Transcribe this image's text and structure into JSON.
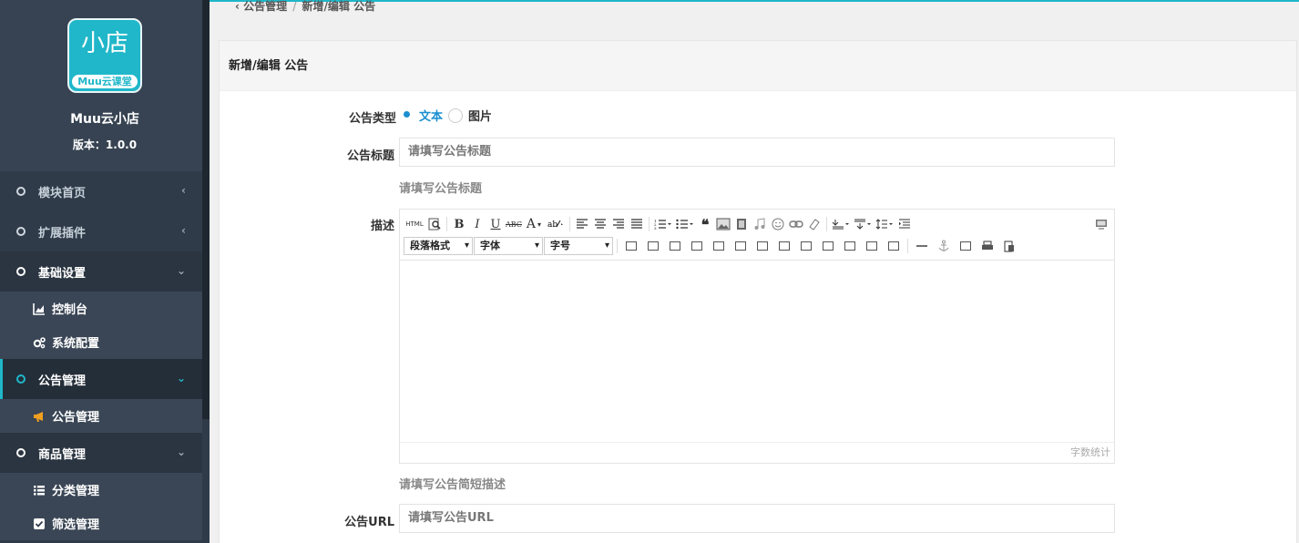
{
  "app": {
    "logo_big": "小店",
    "logo_small": "Muu云课堂",
    "name": "Muu云小店",
    "version": "版本：1.0.0"
  },
  "sidebar": {
    "items": [
      {
        "label": "模块首页"
      },
      {
        "label": "扩展插件"
      },
      {
        "label": "基础设置"
      },
      {
        "label": "公告管理"
      },
      {
        "label": "商品管理"
      }
    ],
    "sub_basic": [
      {
        "label": "控制台"
      },
      {
        "label": "系统配置"
      }
    ],
    "sub_notice": [
      {
        "label": "公告管理"
      }
    ],
    "sub_goods": [
      {
        "label": "分类管理"
      },
      {
        "label": "筛选管理"
      }
    ]
  },
  "breadcrumb": {
    "back": "‹ 公告管理",
    "sep": "/",
    "current": "新增/编辑 公告"
  },
  "panel": {
    "title": "新增/编辑 公告"
  },
  "form": {
    "type_label": "公告类型",
    "type_text": "文本",
    "type_image": "图片",
    "title_label": "公告标题",
    "title_placeholder": "请填写公告标题",
    "title_hint": "请填写公告标题",
    "desc_label": "描述",
    "desc_hint": "请填写公告简短描述",
    "url_label": "公告URL",
    "url_placeholder": "请填写公告URL"
  },
  "editor": {
    "html": "HTML",
    "para_select": "段落格式",
    "font_select": "字体",
    "size_select": "字号",
    "word_count": "字数统计",
    "bold": "B",
    "italic": "I",
    "underline": "U",
    "strike": "ABC",
    "fontcolor": "A",
    "quote": "❝"
  },
  "colors": {
    "accent": "#1fb7c9",
    "sidebar": "#2f3b48",
    "radio": "#1a8fd0"
  }
}
